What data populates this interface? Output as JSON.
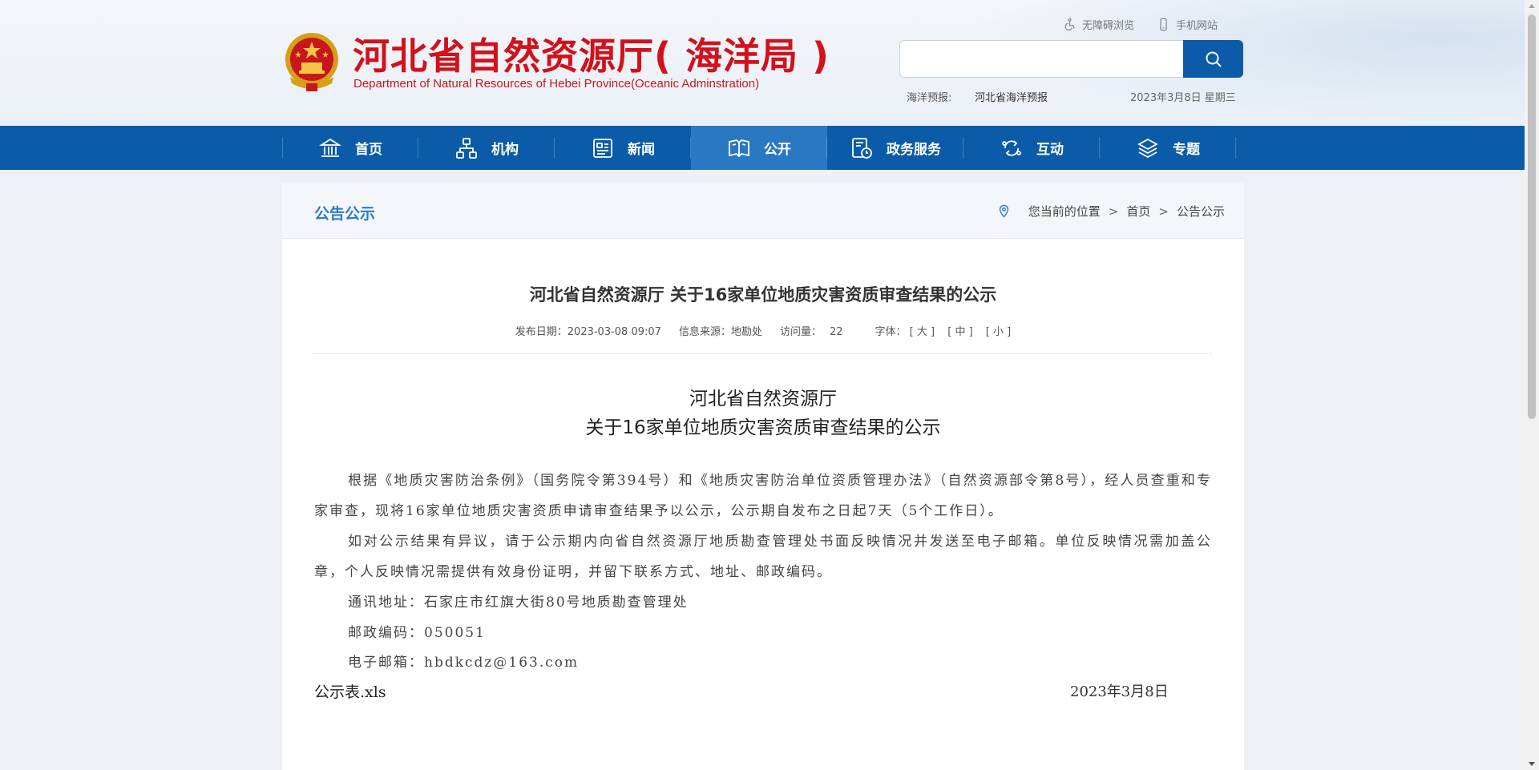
{
  "header": {
    "site_title": "河北省自然资源厅( 海洋局 )",
    "site_subtitle": "Department of Natural Resources of Hebei Province(Oceanic Adminstration)",
    "accessibility_link": "无障碍浏览",
    "mobile_link": "手机网站",
    "search_placeholder": "",
    "forecast_label": "海洋预报:",
    "forecast_link": "河北省海洋预报",
    "date": "2023年3月8日 星期三",
    "brand_color": "#d2111b"
  },
  "nav": {
    "items": [
      {
        "label": "首页",
        "icon": "home-icon"
      },
      {
        "label": "机构",
        "icon": "org-chart-icon"
      },
      {
        "label": "新闻",
        "icon": "news-icon"
      },
      {
        "label": "公开",
        "icon": "open-book-icon"
      },
      {
        "label": "政务服务",
        "icon": "service-icon"
      },
      {
        "label": "互动",
        "icon": "interaction-icon"
      },
      {
        "label": "专题",
        "icon": "layers-icon"
      }
    ],
    "active": "公开",
    "color": "#0b5ba8",
    "active_color": "#2a78c1"
  },
  "section": {
    "title": "公告公示",
    "breadcrumb": {
      "prefix": "您当前的位置",
      "home": "首页",
      "current": "公告公示",
      "separator": ">"
    }
  },
  "article": {
    "title": "河北省自然资源厅 关于16家单位地质灾害资质审查结果的公示",
    "meta": {
      "publish": "发布日期：2023-03-08 09:07",
      "source": "信息来源：地勘处",
      "visits_label": "访问量：",
      "visits": "22",
      "font_label": "字体：",
      "font_large": "[ 大 ]",
      "font_medium": "[ 中 ]",
      "font_small": "[ 小 ]"
    },
    "heading_line1": "河北省自然资源厅",
    "heading_line2": "关于16家单位地质灾害资质审查结果的公示",
    "paragraph1": "根据《地质灾害防治条例》（国务院令第394号）和《地质灾害防治单位资质管理办法》（自然资源部令第8号），经人员查重和专家审查，现将16家单位地质灾害资质申请审查结果予以公示，公示期自发布之日起7天（5个工作日）。",
    "paragraph2": "如对公示结果有异议，请于公示期内向省自然资源厅地质勘查管理处书面反映情况并发送至电子邮箱。单位反映情况需加盖公章，个人反映情况需提供有效身份证明，并留下联系方式、地址、邮政编码。",
    "address": "通讯地址：石家庄市红旗大街80号地质勘查管理处",
    "postcode": "邮政编码：050051",
    "email": "电子邮箱：hbdkcdz@163.com",
    "attachment": "公示表.xls",
    "sign_date": "2023年3月8日"
  }
}
